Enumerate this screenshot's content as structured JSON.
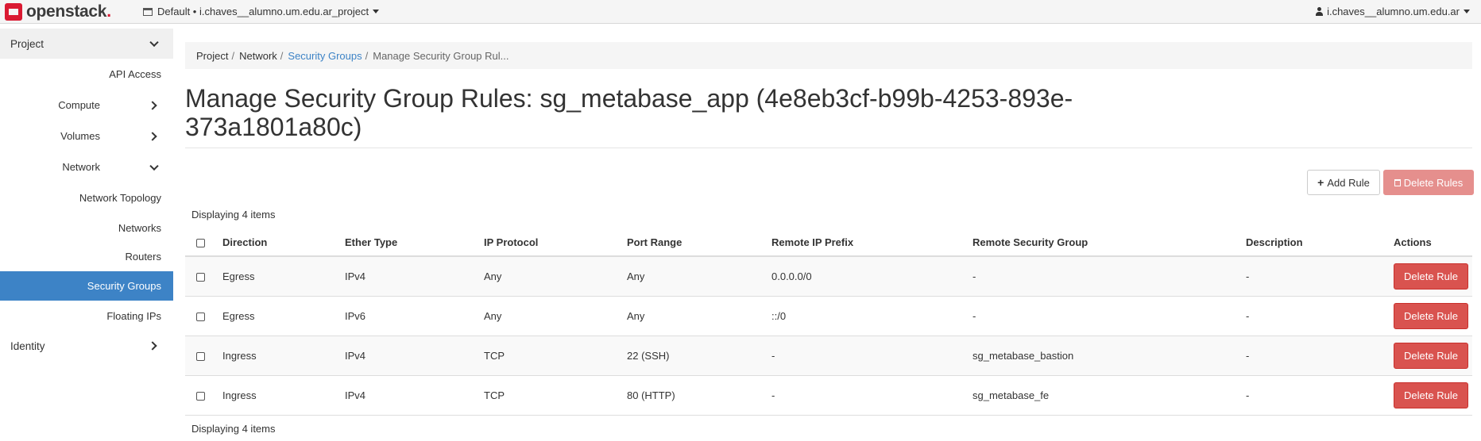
{
  "brand": {
    "name": "openstack",
    "dot": "."
  },
  "topbar": {
    "project_label": "Default • i.chaves__alumno.um.edu.ar_project",
    "user_label": "i.chaves__alumno.um.edu.ar"
  },
  "sidebar": {
    "project": "Project",
    "api_access": "API Access",
    "compute": "Compute",
    "volumes": "Volumes",
    "network": "Network",
    "network_topology": "Network Topology",
    "networks": "Networks",
    "routers": "Routers",
    "security_groups": "Security Groups",
    "floating_ips": "Floating IPs",
    "identity": "Identity"
  },
  "breadcrumb": [
    "Project",
    "Network",
    "Security Groups",
    "Manage Security Group Rul..."
  ],
  "page_title": "Manage Security Group Rules: sg_metabase_app (4e8eb3cf-b99b-4253-893e-373a1801a80c)",
  "actions": {
    "add_rule": "Add Rule",
    "delete_rules": "Delete Rules"
  },
  "table": {
    "count_text": "Displaying 4 items",
    "columns": [
      "Direction",
      "Ether Type",
      "IP Protocol",
      "Port Range",
      "Remote IP Prefix",
      "Remote Security Group",
      "Description",
      "Actions"
    ],
    "rows": [
      [
        "Egress",
        "IPv4",
        "Any",
        "Any",
        "0.0.0.0/0",
        "-",
        "-",
        "Delete Rule"
      ],
      [
        "Egress",
        "IPv6",
        "Any",
        "Any",
        "::/0",
        "-",
        "-",
        "Delete Rule"
      ],
      [
        "Ingress",
        "IPv4",
        "TCP",
        "22 (SSH)",
        "-",
        "sg_metabase_bastion",
        "-",
        "Delete Rule"
      ],
      [
        "Ingress",
        "IPv4",
        "TCP",
        "80 (HTTP)",
        "-",
        "sg_metabase_fe",
        "-",
        "Delete Rule"
      ]
    ]
  }
}
